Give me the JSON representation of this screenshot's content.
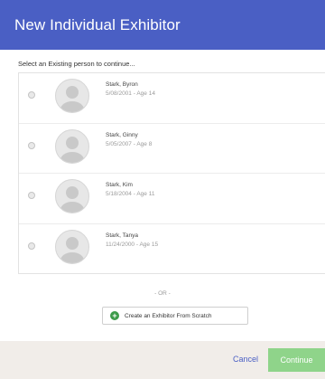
{
  "header": {
    "title": "New Individual Exhibitor"
  },
  "prompt": "Select an Existing person to continue...",
  "people": [
    {
      "name": "Stark, Byron",
      "meta": "5/08/2001 - Age 14"
    },
    {
      "name": "Stark, Ginny",
      "meta": "5/05/2007 - Age 8"
    },
    {
      "name": "Stark, Kim",
      "meta": "5/18/2004 - Age 11"
    },
    {
      "name": "Stark, Tanya",
      "meta": "11/24/2000 - Age 15"
    }
  ],
  "separator": "- OR -",
  "create_button": {
    "label": "Create an Exhibitor From Scratch",
    "icon": "plus-circle-icon"
  },
  "footer": {
    "cancel_label": "Cancel",
    "continue_label": "Continue"
  },
  "colors": {
    "header": "#4a5fc4",
    "continue": "#8fd48a",
    "plus": "#3d9b4a",
    "footer": "#f1ede9"
  }
}
